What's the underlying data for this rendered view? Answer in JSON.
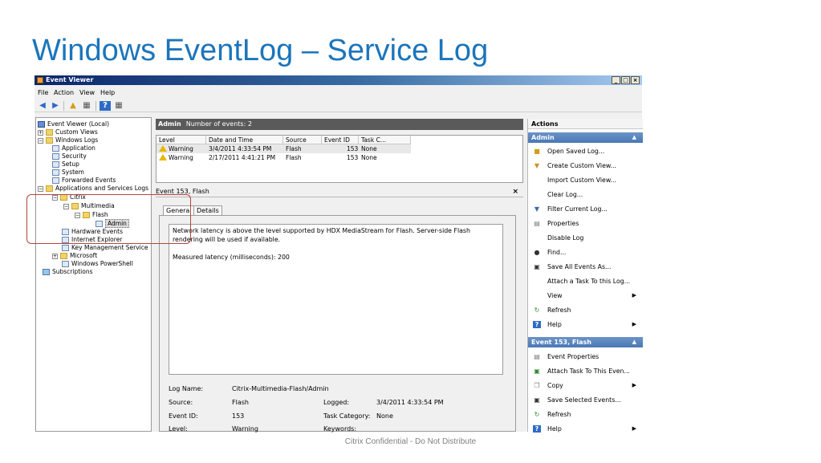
{
  "slide": {
    "title": "Windows EventLog – Service Log",
    "footer": "Citrix Confidential - Do Not Distribute"
  },
  "window": {
    "title": "Event Viewer",
    "menu": [
      "File",
      "Action",
      "View",
      "Help"
    ]
  },
  "tree": [
    {
      "label": "Event Viewer (Local)",
      "icon": "viewer-icon",
      "expander": ""
    },
    {
      "label": "Custom Views",
      "icon": "folder-icon",
      "expander": "+"
    },
    {
      "label": "Windows Logs",
      "icon": "folder-icon",
      "expander": "−"
    },
    {
      "label": "Application",
      "icon": "log-icon",
      "expander": ""
    },
    {
      "label": "Security",
      "icon": "log-icon",
      "expander": ""
    },
    {
      "label": "Setup",
      "icon": "log-icon",
      "expander": ""
    },
    {
      "label": "System",
      "icon": "log-icon",
      "expander": ""
    },
    {
      "label": "Forwarded Events",
      "icon": "log-icon",
      "expander": ""
    },
    {
      "label": "Applications and Services Logs",
      "icon": "folder-icon",
      "expander": "−"
    },
    {
      "label": "Citrix",
      "icon": "folder-icon",
      "expander": "−"
    },
    {
      "label": "Multimedia",
      "icon": "folder-icon",
      "expander": "−"
    },
    {
      "label": "Flash",
      "icon": "folder-icon",
      "expander": "−"
    },
    {
      "label": "Admin",
      "icon": "log-icon",
      "expander": ""
    },
    {
      "label": "Hardware Events",
      "icon": "log-icon",
      "expander": ""
    },
    {
      "label": "Internet Explorer",
      "icon": "log-icon",
      "expander": ""
    },
    {
      "label": "Key Management Service",
      "icon": "log-icon",
      "expander": ""
    },
    {
      "label": "Microsoft",
      "icon": "folder-icon",
      "expander": "+"
    },
    {
      "label": "Windows PowerShell",
      "icon": "log-icon",
      "expander": ""
    },
    {
      "label": "Subscriptions",
      "icon": "subscriptions-icon",
      "expander": ""
    }
  ],
  "center": {
    "log_name": "Admin",
    "event_count": "Number of events: 2",
    "columns": [
      "Level",
      "Date and Time",
      "Source",
      "Event ID",
      "Task C..."
    ],
    "rows": [
      {
        "level": "Warning",
        "datetime": "3/4/2011 4:33:54 PM",
        "source": "Flash",
        "event_id": "153",
        "task": "None"
      },
      {
        "level": "Warning",
        "datetime": "2/17/2011 4:41:21 PM",
        "source": "Flash",
        "event_id": "153",
        "task": "None"
      }
    ],
    "detail_title": "Event 153, Flash",
    "close": "×",
    "tabs": [
      "General",
      "Details"
    ],
    "description": "Network latency is above the level supported by HDX MediaStream for Flash.  Server-side Flash rendering will be used if available.",
    "measured": "Measured latency (milliseconds): 200",
    "fields": {
      "log_name_label": "Log Name:",
      "log_name_value": "Citrix-Multimedia-Flash/Admin",
      "source_label": "Source:",
      "source_value": "Flash",
      "logged_label": "Logged:",
      "logged_value": "3/4/2011 4:33:54 PM",
      "event_id_label": "Event ID:",
      "event_id_value": "153",
      "task_category_label": "Task Category:",
      "task_category_value": "None",
      "level_label": "Level:",
      "level_value": "Warning",
      "keywords_label": "Keywords:"
    }
  },
  "actions": {
    "title": "Actions",
    "section1": "Admin",
    "items1": [
      {
        "label": "Open Saved Log...",
        "icon": "open-log-icon",
        "arrow": false
      },
      {
        "label": "Create Custom View...",
        "icon": "filter-icon",
        "arrow": false
      },
      {
        "label": "Import Custom View...",
        "icon": "",
        "arrow": false
      },
      {
        "label": "Clear Log...",
        "icon": "",
        "arrow": false
      },
      {
        "label": "Filter Current Log...",
        "icon": "filter-icon",
        "arrow": false
      },
      {
        "label": "Properties",
        "icon": "properties-icon",
        "arrow": false
      },
      {
        "label": "Disable Log",
        "icon": "",
        "arrow": false
      },
      {
        "label": "Find...",
        "icon": "binoculars-icon",
        "arrow": false
      },
      {
        "label": "Save All Events As...",
        "icon": "save-icon",
        "arrow": false
      },
      {
        "label": "Attach a Task To this Log...",
        "icon": "",
        "arrow": false
      },
      {
        "label": "View",
        "icon": "",
        "arrow": true
      },
      {
        "label": "Refresh",
        "icon": "refresh-icon",
        "arrow": false
      },
      {
        "label": "Help",
        "icon": "help-icon",
        "arrow": true
      }
    ],
    "section2": "Event 153, Flash",
    "items2": [
      {
        "label": "Event Properties",
        "icon": "properties-icon",
        "arrow": false
      },
      {
        "label": "Attach Task To This Even...",
        "icon": "task-icon",
        "arrow": false
      },
      {
        "label": "Copy",
        "icon": "copy-icon",
        "arrow": true
      },
      {
        "label": "Save Selected Events...",
        "icon": "save-icon",
        "arrow": false
      },
      {
        "label": "Refresh",
        "icon": "refresh-icon",
        "arrow": false
      },
      {
        "label": "Help",
        "icon": "help-icon",
        "arrow": true
      }
    ]
  }
}
